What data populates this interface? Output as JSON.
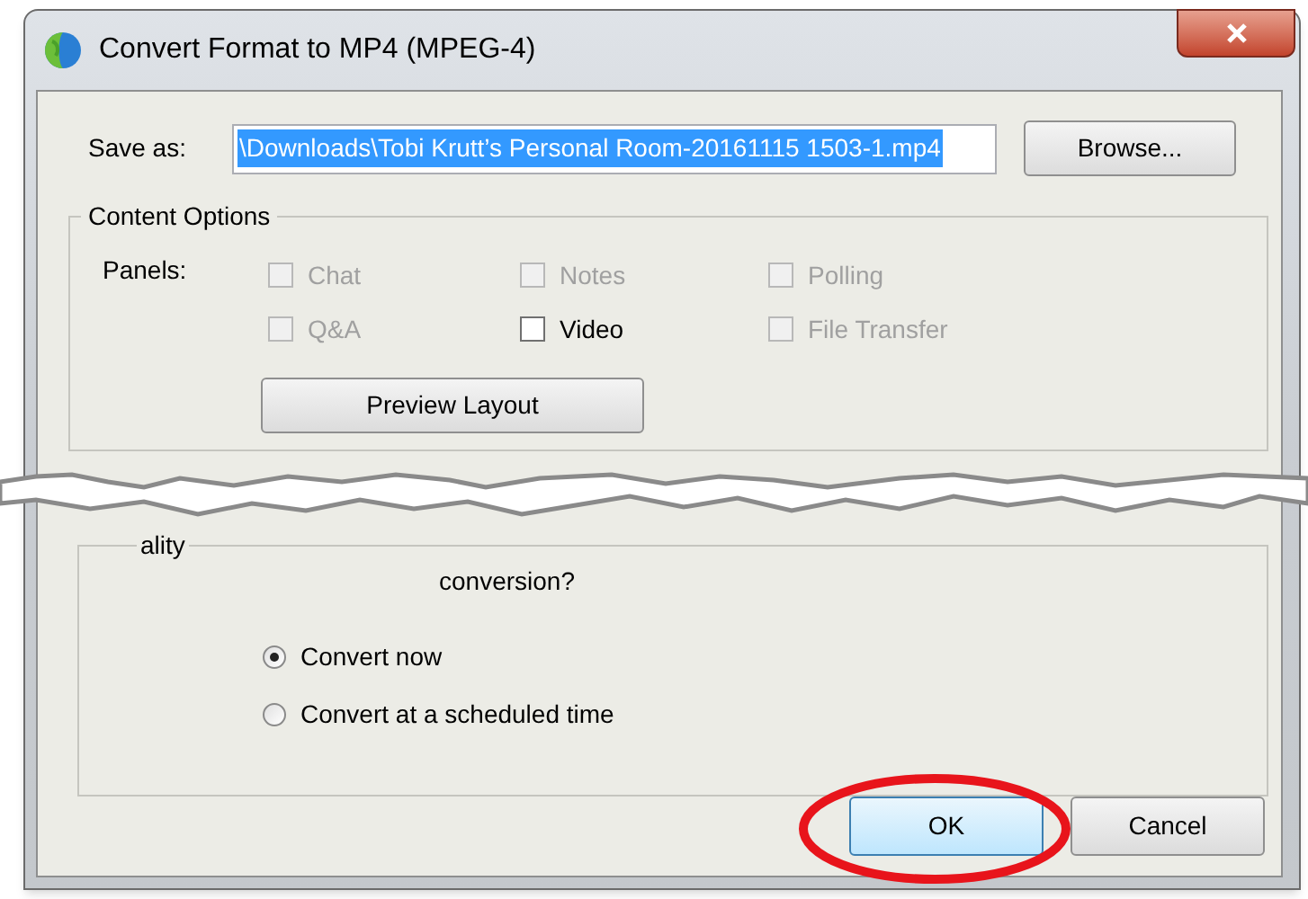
{
  "window": {
    "title": "Convert Format to MP4 (MPEG-4)"
  },
  "save_as": {
    "label": "Save as:",
    "value": "\\Downloads\\Tobi Krutt’s Personal Room-20161115 1503-1.mp4",
    "selected": true
  },
  "browse_button": "Browse...",
  "content_options": {
    "title": "Content Options",
    "panels_label": "Panels:",
    "panels": [
      {
        "label": "Chat",
        "checked": false,
        "disabled": true
      },
      {
        "label": "Notes",
        "checked": false,
        "disabled": true
      },
      {
        "label": "Polling",
        "checked": false,
        "disabled": true
      },
      {
        "label": "Q&A",
        "checked": false,
        "disabled": true
      },
      {
        "label": "Video",
        "checked": false,
        "disabled": false
      },
      {
        "label": "File Transfer",
        "checked": false,
        "disabled": true
      }
    ],
    "preview_button": "Preview Layout"
  },
  "lower_group": {
    "title_fragment": "ality",
    "question_fragment": "conversion?",
    "options": [
      {
        "label": "Convert now",
        "selected": true
      },
      {
        "label": "Convert at a scheduled time",
        "selected": false
      }
    ]
  },
  "buttons": [
    {
      "label": "OK",
      "default": true,
      "highlighted": true
    },
    {
      "label": "Cancel",
      "default": false,
      "highlighted": false
    }
  ]
}
